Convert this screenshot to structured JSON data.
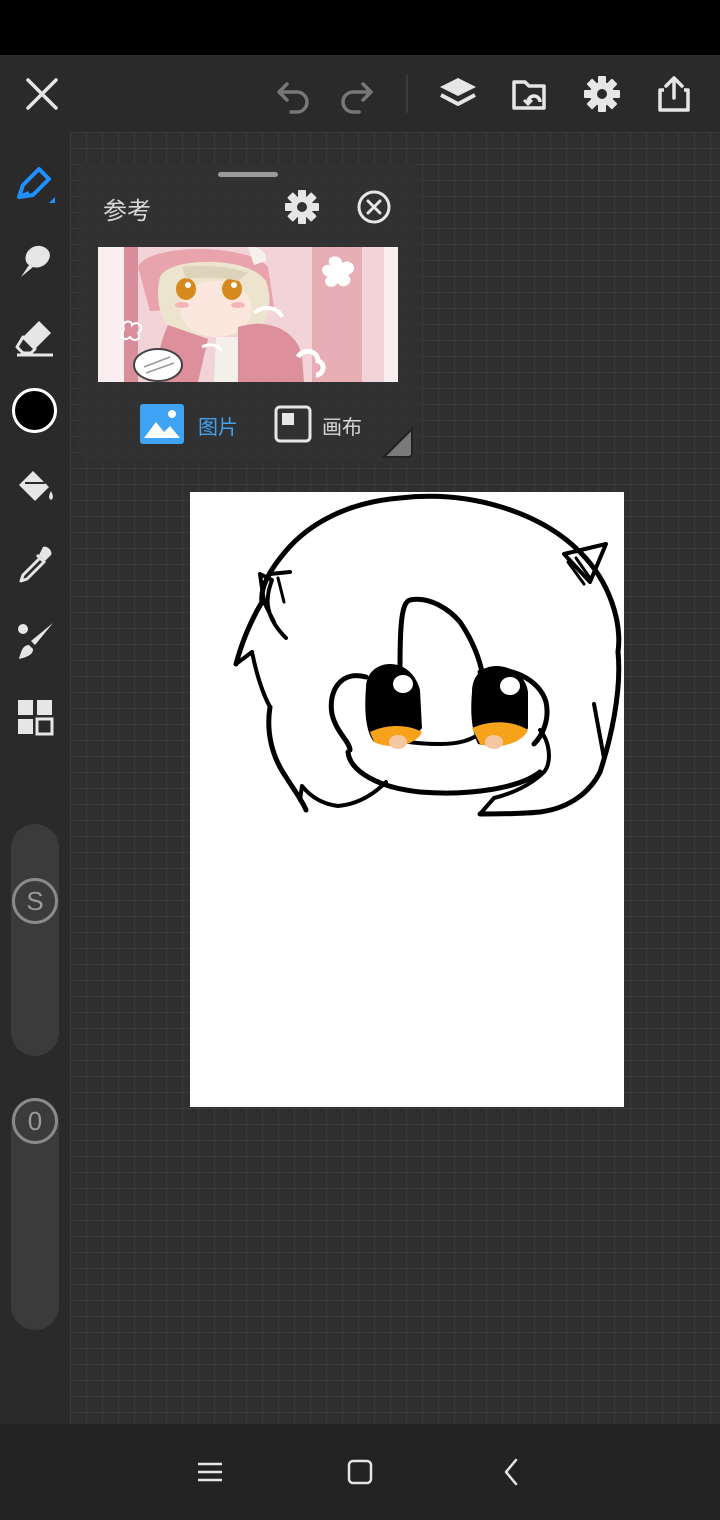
{
  "reference_panel": {
    "title": "参考",
    "mode_image_label": "图片",
    "mode_canvas_label": "画布",
    "selected_mode": "图片"
  },
  "toolbar": {
    "icons": [
      "close-icon",
      "undo-icon",
      "redo-icon",
      "layers-icon",
      "open-file-icon",
      "settings-icon",
      "share-icon"
    ]
  },
  "left_tools": {
    "icons": [
      "pen-icon",
      "smudge-icon",
      "eraser-icon",
      "color-swatch",
      "bucket-icon",
      "eyedropper-icon",
      "brush-icon",
      "grid-icon"
    ],
    "current_color": "#000000",
    "size_slider_label": "S",
    "opacity_slider_label": "0"
  },
  "colors": {
    "accent": "#1e90ff",
    "selected_mode_text": "#3ea3f2",
    "canvas_bg": "#2f2f2f"
  }
}
